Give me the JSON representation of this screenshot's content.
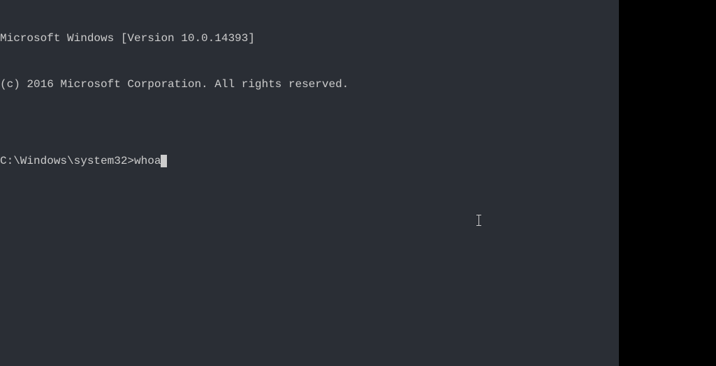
{
  "terminal": {
    "lines": [
      "Microsoft Windows [Version 10.0.14393]",
      "(c) 2016 Microsoft Corporation. All rights reserved.",
      ""
    ],
    "prompt": "C:\\Windows\\system32>",
    "command": "whoa"
  }
}
